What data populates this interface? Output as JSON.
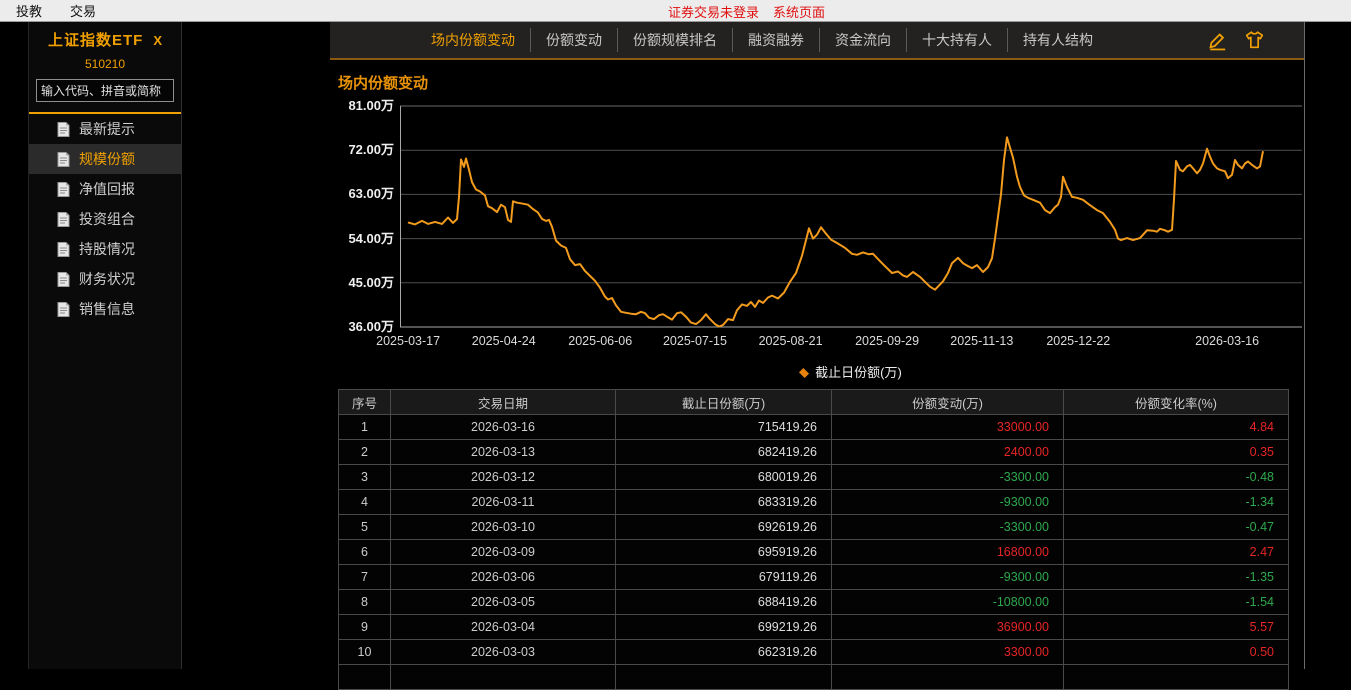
{
  "colors": {
    "accent": "#f0a000",
    "line": "#f29b1d",
    "up_red": "#e62525",
    "down_green": "#2ea84e",
    "alert_red": "#e01010"
  },
  "menubar": {
    "items": [
      "投教",
      "交易"
    ],
    "alerts": [
      "证券交易未登录",
      "系统页面"
    ]
  },
  "sidebar": {
    "fund_name": "上证指数ETF",
    "close_label": "X",
    "fund_code": "510210",
    "search_placeholder": "输入代码、拼音或简称",
    "items": [
      {
        "label": "最新提示",
        "active": false
      },
      {
        "label": "规模份额",
        "active": true
      },
      {
        "label": "净值回报",
        "active": false
      },
      {
        "label": "投资组合",
        "active": false
      },
      {
        "label": "持股情况",
        "active": false
      },
      {
        "label": "财务状况",
        "active": false
      },
      {
        "label": "销售信息",
        "active": false
      }
    ]
  },
  "tabs": [
    {
      "label": "场内份额变动",
      "active": true
    },
    {
      "label": "份额变动",
      "active": false
    },
    {
      "label": "份额规模排名",
      "active": false
    },
    {
      "label": "融资融券",
      "active": false
    },
    {
      "label": "资金流向",
      "active": false
    },
    {
      "label": "十大持有人",
      "active": false
    },
    {
      "label": "持有人结构",
      "active": false
    }
  ],
  "toolbar_icons": [
    "edit-pen-icon",
    "tshirt-theme-icon"
  ],
  "content": {
    "section_title": "场内份额变动"
  },
  "chart_data": {
    "type": "line",
    "title": "场内份额变动",
    "legend": "截止日份额(万)",
    "legend_position": "bottom-center",
    "grid": true,
    "line_color": "#f29b1d",
    "ylim": [
      36,
      81
    ],
    "yticks": [
      {
        "label": "81.00万",
        "value": 81
      },
      {
        "label": "72.00万",
        "value": 72
      },
      {
        "label": "63.00万",
        "value": 63
      },
      {
        "label": "54.00万",
        "value": 54
      },
      {
        "label": "45.00万",
        "value": 45
      },
      {
        "label": "36.00万",
        "value": 36
      }
    ],
    "xticks": [
      {
        "label": "2025-03-17",
        "pos": 0.009
      },
      {
        "label": "2025-04-24",
        "pos": 0.115
      },
      {
        "label": "2025-06-06",
        "pos": 0.222
      },
      {
        "label": "2025-07-15",
        "pos": 0.327
      },
      {
        "label": "2025-08-21",
        "pos": 0.433
      },
      {
        "label": "2025-09-29",
        "pos": 0.54
      },
      {
        "label": "2025-11-13",
        "pos": 0.645
      },
      {
        "label": "2025-12-22",
        "pos": 0.752
      },
      {
        "label": "2026-03-16",
        "pos": 0.917
      }
    ],
    "series": [
      {
        "name": "截止日份额(万)",
        "points": [
          [
            8,
            57.3
          ],
          [
            15,
            56.9
          ],
          [
            22,
            57.6
          ],
          [
            28,
            57.0
          ],
          [
            35,
            57.4
          ],
          [
            42,
            57.0
          ],
          [
            48,
            58.3
          ],
          [
            53,
            57.2
          ],
          [
            57,
            58.0
          ],
          [
            59,
            62.5
          ],
          [
            61,
            70.1
          ],
          [
            64,
            68.6
          ],
          [
            66,
            70.3
          ],
          [
            69,
            68.0
          ],
          [
            72,
            65.5
          ],
          [
            76,
            64.0
          ],
          [
            80,
            63.6
          ],
          [
            85,
            62.8
          ],
          [
            88,
            60.6
          ],
          [
            92,
            60.2
          ],
          [
            97,
            59.4
          ],
          [
            101,
            60.9
          ],
          [
            105,
            60.4
          ],
          [
            108,
            57.8
          ],
          [
            111,
            57.4
          ],
          [
            113,
            61.6
          ],
          [
            117,
            61.3
          ],
          [
            123,
            61.1
          ],
          [
            128,
            60.9
          ],
          [
            133,
            60.0
          ],
          [
            138,
            59.3
          ],
          [
            142,
            58.0
          ],
          [
            146,
            57.6
          ],
          [
            149,
            57.8
          ],
          [
            152,
            56.4
          ],
          [
            156,
            53.6
          ],
          [
            161,
            52.6
          ],
          [
            166,
            52.1
          ],
          [
            170,
            49.8
          ],
          [
            175,
            48.6
          ],
          [
            180,
            48.8
          ],
          [
            185,
            47.4
          ],
          [
            190,
            46.4
          ],
          [
            195,
            45.4
          ],
          [
            200,
            44.0
          ],
          [
            205,
            42.2
          ],
          [
            208,
            41.6
          ],
          [
            212,
            41.9
          ],
          [
            216,
            40.4
          ],
          [
            221,
            39.1
          ],
          [
            226,
            38.9
          ],
          [
            231,
            38.7
          ],
          [
            236,
            38.6
          ],
          [
            241,
            39.1
          ],
          [
            245,
            38.8
          ],
          [
            249,
            37.9
          ],
          [
            254,
            37.6
          ],
          [
            259,
            38.4
          ],
          [
            263,
            38.6
          ],
          [
            267,
            38.1
          ],
          [
            272,
            37.5
          ],
          [
            277,
            38.8
          ],
          [
            281,
            39.0
          ],
          [
            286,
            38.1
          ],
          [
            291,
            36.9
          ],
          [
            296,
            36.6
          ],
          [
            301,
            37.4
          ],
          [
            306,
            38.6
          ],
          [
            310,
            37.6
          ],
          [
            315,
            36.6
          ],
          [
            319,
            36.1
          ],
          [
            323,
            36.4
          ],
          [
            328,
            37.6
          ],
          [
            333,
            37.4
          ],
          [
            337,
            39.4
          ],
          [
            342,
            40.6
          ],
          [
            347,
            40.3
          ],
          [
            351,
            41.1
          ],
          [
            355,
            40.1
          ],
          [
            359,
            41.4
          ],
          [
            363,
            40.9
          ],
          [
            368,
            42.0
          ],
          [
            372,
            42.4
          ],
          [
            378,
            41.8
          ],
          [
            384,
            43.0
          ],
          [
            390,
            45.2
          ],
          [
            396,
            47.0
          ],
          [
            402,
            50.5
          ],
          [
            406,
            53.7
          ],
          [
            409,
            56.1
          ],
          [
            413,
            54.0
          ],
          [
            417,
            54.8
          ],
          [
            421,
            56.3
          ],
          [
            426,
            55.0
          ],
          [
            431,
            53.8
          ],
          [
            437,
            53.1
          ],
          [
            445,
            52.1
          ],
          [
            452,
            50.9
          ],
          [
            457,
            50.7
          ],
          [
            463,
            51.2
          ],
          [
            469,
            50.8
          ],
          [
            473,
            50.9
          ],
          [
            482,
            49.0
          ],
          [
            492,
            47.0
          ],
          [
            498,
            47.3
          ],
          [
            503,
            46.5
          ],
          [
            507,
            46.2
          ],
          [
            513,
            47.2
          ],
          [
            520,
            46.2
          ],
          [
            526,
            45.0
          ],
          [
            530,
            44.2
          ],
          [
            535,
            43.6
          ],
          [
            543,
            45.3
          ],
          [
            548,
            47.0
          ],
          [
            552,
            49.0
          ],
          [
            558,
            50.1
          ],
          [
            563,
            49.0
          ],
          [
            568,
            48.4
          ],
          [
            572,
            48.0
          ],
          [
            577,
            48.6
          ],
          [
            583,
            47.2
          ],
          [
            588,
            48.2
          ],
          [
            592,
            50.0
          ],
          [
            595,
            54.0
          ],
          [
            598,
            58.5
          ],
          [
            601,
            63.0
          ],
          [
            604,
            70.0
          ],
          [
            607,
            74.6
          ],
          [
            610,
            72.5
          ],
          [
            613,
            70.5
          ],
          [
            617,
            66.6
          ],
          [
            620,
            64.5
          ],
          [
            624,
            62.8
          ],
          [
            628,
            62.3
          ],
          [
            633,
            61.9
          ],
          [
            640,
            61.3
          ],
          [
            645,
            59.8
          ],
          [
            650,
            59.2
          ],
          [
            655,
            60.4
          ],
          [
            658,
            60.9
          ],
          [
            661,
            62.5
          ],
          [
            663,
            66.6
          ],
          [
            667,
            64.5
          ],
          [
            672,
            62.5
          ],
          [
            677,
            62.3
          ],
          [
            683,
            61.9
          ],
          [
            690,
            60.8
          ],
          [
            697,
            59.8
          ],
          [
            703,
            59.2
          ],
          [
            710,
            57.4
          ],
          [
            715,
            55.8
          ],
          [
            718,
            54.0
          ],
          [
            721,
            53.7
          ],
          [
            727,
            54.1
          ],
          [
            733,
            53.7
          ],
          [
            740,
            54.1
          ],
          [
            747,
            55.7
          ],
          [
            753,
            55.6
          ],
          [
            757,
            55.4
          ],
          [
            760,
            56.0
          ],
          [
            765,
            55.7
          ],
          [
            768,
            55.4
          ],
          [
            772,
            55.8
          ],
          [
            774,
            62.0
          ],
          [
            776,
            69.8
          ],
          [
            780,
            68.0
          ],
          [
            783,
            67.7
          ],
          [
            787,
            68.7
          ],
          [
            790,
            69.0
          ],
          [
            793,
            68.3
          ],
          [
            797,
            67.3
          ],
          [
            800,
            68.0
          ],
          [
            803,
            69.3
          ],
          [
            807,
            72.3
          ],
          [
            810,
            70.7
          ],
          [
            813,
            69.3
          ],
          [
            817,
            68.3
          ],
          [
            820,
            68.0
          ],
          [
            825,
            67.7
          ],
          [
            828,
            66.3
          ],
          [
            832,
            67.0
          ],
          [
            835,
            70.0
          ],
          [
            838,
            69.0
          ],
          [
            842,
            68.3
          ],
          [
            845,
            69.3
          ],
          [
            848,
            69.7
          ],
          [
            852,
            69.0
          ],
          [
            857,
            68.3
          ],
          [
            860,
            68.7
          ],
          [
            863,
            71.8
          ]
        ]
      }
    ]
  },
  "table": {
    "headers": [
      "序号",
      "交易日期",
      "截止日份额(万)",
      "份额变动(万)",
      "份额变化率(%)"
    ],
    "rows": [
      [
        "1",
        "2026-03-16",
        "715419.26",
        "33000.00",
        "4.84"
      ],
      [
        "2",
        "2026-03-13",
        "682419.26",
        "2400.00",
        "0.35"
      ],
      [
        "3",
        "2026-03-12",
        "680019.26",
        "-3300.00",
        "-0.48"
      ],
      [
        "4",
        "2026-03-11",
        "683319.26",
        "-9300.00",
        "-1.34"
      ],
      [
        "5",
        "2026-03-10",
        "692619.26",
        "-3300.00",
        "-0.47"
      ],
      [
        "6",
        "2026-03-09",
        "695919.26",
        "16800.00",
        "2.47"
      ],
      [
        "7",
        "2026-03-06",
        "679119.26",
        "-9300.00",
        "-1.35"
      ],
      [
        "8",
        "2026-03-05",
        "688419.26",
        "-10800.00",
        "-1.54"
      ],
      [
        "9",
        "2026-03-04",
        "699219.26",
        "36900.00",
        "5.57"
      ],
      [
        "10",
        "2026-03-03",
        "662319.26",
        "3300.00",
        "0.50"
      ]
    ]
  }
}
